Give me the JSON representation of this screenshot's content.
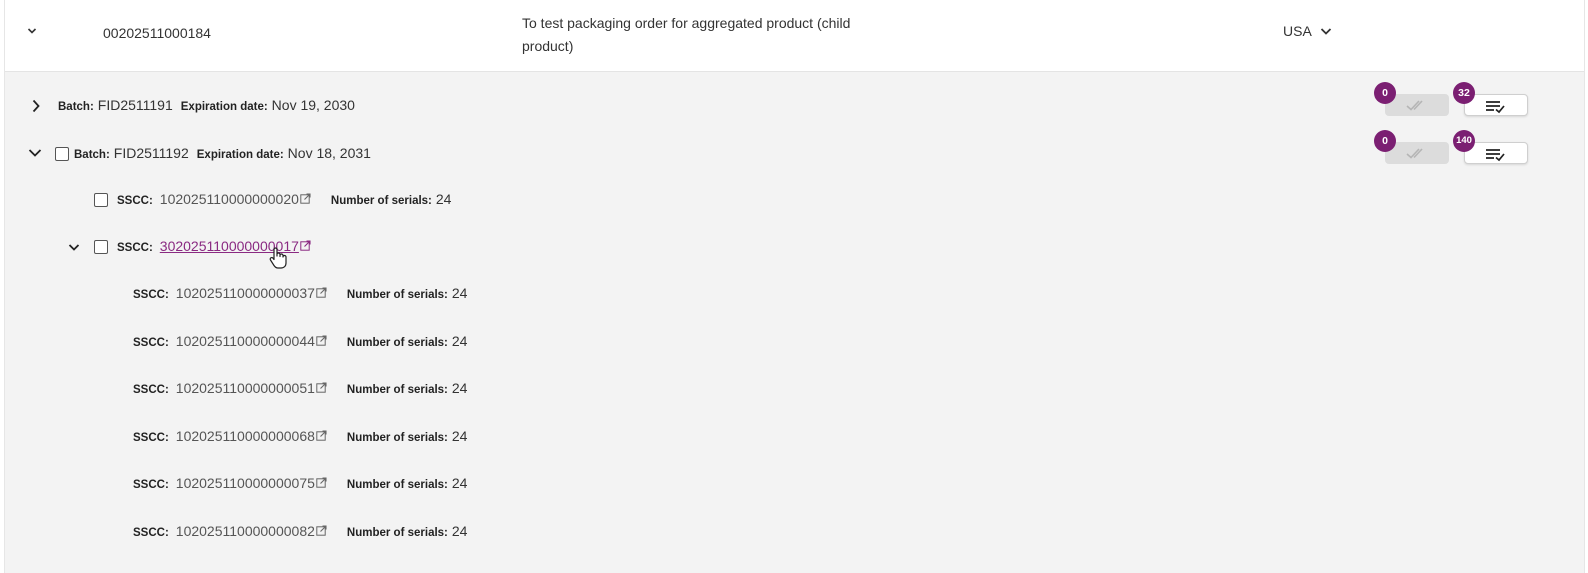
{
  "header": {
    "code": "00202511000184",
    "description": "To test packaging order for aggregated product (child product)",
    "description_line1": "To test packaging order for aggregated product (child",
    "description_line2": "product)",
    "country": "USA"
  },
  "labels": {
    "batch": "Batch:",
    "expiration": "Expiration date:",
    "sscc": "SSCC:",
    "num_serials": "Number of serials:"
  },
  "batches": [
    {
      "batch": "FID2511191",
      "expiration": "Nov 19, 2030",
      "verified_count": "0",
      "total_count": "32"
    },
    {
      "batch": "FID2511192",
      "expiration": "Nov 18, 2031",
      "verified_count": "0",
      "total_count": "140"
    }
  ],
  "level1": [
    {
      "sscc": "102025110000000020",
      "serials": "24"
    },
    {
      "sscc": "302025110000000017"
    }
  ],
  "level2": [
    {
      "sscc": "102025110000000037",
      "serials": "24"
    },
    {
      "sscc": "102025110000000044",
      "serials": "24"
    },
    {
      "sscc": "102025110000000051",
      "serials": "24"
    },
    {
      "sscc": "102025110000000068",
      "serials": "24"
    },
    {
      "sscc": "102025110000000075",
      "serials": "24"
    },
    {
      "sscc": "102025110000000082",
      "serials": "24"
    }
  ],
  "colors": {
    "badge": "#7b1f72",
    "link": "#8a2a82",
    "panel_bg": "#f3f3f3"
  },
  "icons": {
    "collapse": "chevron-down-icon",
    "expand": "chevron-right-icon",
    "external": "external-link-icon",
    "verify": "double-check-icon",
    "list": "list-check-icon",
    "cursor": "hand-pointer-icon"
  }
}
